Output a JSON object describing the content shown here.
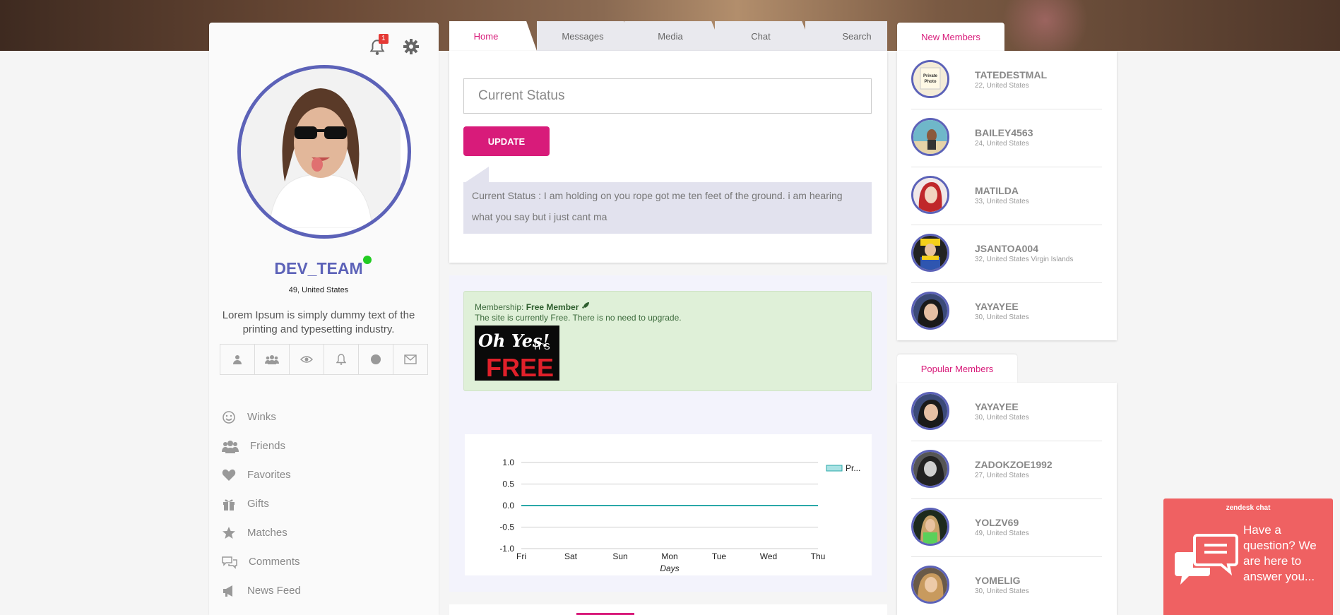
{
  "profile": {
    "notifications_count": "1",
    "username": "DEV_TEAM",
    "location": "49, United States",
    "bio": "Lorem Ipsum is simply dummy text of the printing and typesetting industry."
  },
  "profile_icons": [
    "user-icon",
    "group-icon",
    "eye-icon",
    "bell-icon",
    "circle-icon",
    "envelope-icon"
  ],
  "left_nav": [
    {
      "label": "Winks",
      "icon": "smile-icon"
    },
    {
      "label": "Friends",
      "icon": "users-icon"
    },
    {
      "label": "Favorites",
      "icon": "heart-icon"
    },
    {
      "label": "Gifts",
      "icon": "gift-icon"
    },
    {
      "label": "Matches",
      "icon": "star-icon"
    },
    {
      "label": "Comments",
      "icon": "comments-icon"
    },
    {
      "label": "News Feed",
      "icon": "bullhorn-icon"
    }
  ],
  "tabs": [
    "Home",
    "Messages",
    "Media",
    "Chat",
    "Search"
  ],
  "status": {
    "placeholder": "Current Status",
    "update_label": "UPDATE",
    "current_text": "Current Status : I am holding on you rope got me ten feet of the ground. i am hearing what you say but i just cant ma"
  },
  "membership": {
    "label": "Membership:",
    "level": "Free Member",
    "note": "The site is currently Free. There is no need to upgrade.",
    "image_text_1": "Oh Yes!",
    "image_text_2": "IT'S",
    "image_text_3": "FREE"
  },
  "chart_data": {
    "type": "line",
    "categories": [
      "Fri",
      "Sat",
      "Sun",
      "Mon",
      "Tue",
      "Wed",
      "Thu"
    ],
    "series": [
      {
        "name": "Pr...",
        "values": [
          0,
          0,
          0,
          0,
          0,
          0,
          0
        ]
      }
    ],
    "xlabel": "Days",
    "ylabel": "",
    "ylim": [
      -1.0,
      1.0
    ],
    "yticks": [
      "1.0",
      "0.5",
      "0.0",
      "-0.5",
      "-1.0"
    ],
    "grid": true,
    "legend": "right",
    "color": "#2aa8a8"
  },
  "new_members": {
    "title": "New Members",
    "items": [
      {
        "name": "TATEDESTMAL",
        "loc": "22, United States",
        "avatar_text": "Private Photo"
      },
      {
        "name": "BAILEY4563",
        "loc": "24, United States"
      },
      {
        "name": "MATILDA",
        "loc": "33, United States"
      },
      {
        "name": "JSANTOA004",
        "loc": "32, United States Virgin Islands"
      },
      {
        "name": "YAYAYEE",
        "loc": "30, United States"
      }
    ]
  },
  "popular_members": {
    "title": "Popular Members",
    "items": [
      {
        "name": "YAYAYEE",
        "loc": "30, United States"
      },
      {
        "name": "ZADOKZOE1992",
        "loc": "27, United States"
      },
      {
        "name": "YOLZV69",
        "loc": "49, United States"
      },
      {
        "name": "YOMELIG",
        "loc": "30, United States"
      }
    ]
  },
  "zendesk": {
    "title": "zendesk chat",
    "question": "Have a question? We are here to answer you..."
  },
  "colors": {
    "accent": "#d81b7a",
    "avatar_ring": "#5c62b8",
    "online": "#22cc22",
    "zendesk": "#ef6162"
  }
}
